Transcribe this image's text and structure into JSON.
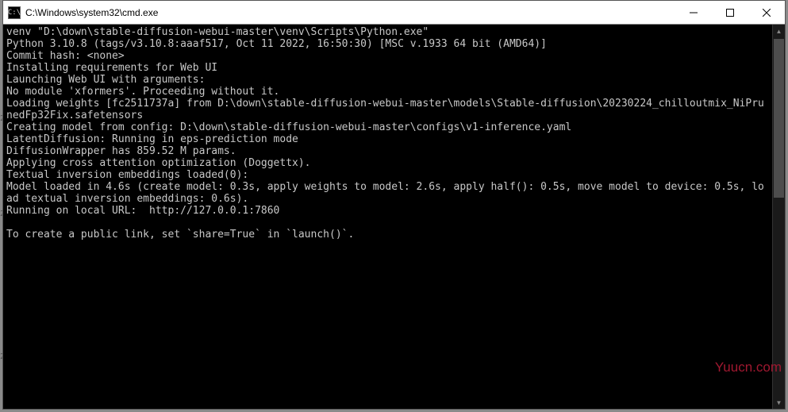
{
  "window": {
    "title": "C:\\Windows\\system32\\cmd.exe",
    "icon_label": "C:\\"
  },
  "terminal": {
    "lines": [
      "venv \"D:\\down\\stable-diffusion-webui-master\\venv\\Scripts\\Python.exe\"",
      "Python 3.10.8 (tags/v3.10.8:aaaf517, Oct 11 2022, 16:50:30) [MSC v.1933 64 bit (AMD64)]",
      "Commit hash: <none>",
      "Installing requirements for Web UI",
      "Launching Web UI with arguments:",
      "No module 'xformers'. Proceeding without it.",
      "Loading weights [fc2511737a] from D:\\down\\stable-diffusion-webui-master\\models\\Stable-diffusion\\20230224_chilloutmix_NiPrunedFp32Fix.safetensors",
      "Creating model from config: D:\\down\\stable-diffusion-webui-master\\configs\\v1-inference.yaml",
      "LatentDiffusion: Running in eps-prediction mode",
      "DiffusionWrapper has 859.52 M params.",
      "Applying cross attention optimization (Doggettx).",
      "Textual inversion embeddings loaded(0):",
      "Model loaded in 4.6s (create model: 0.3s, apply weights to model: 2.6s, apply half(): 0.5s, move model to device: 0.5s, load textual inversion embeddings: 0.6s).",
      "Running on local URL:  http://127.0.0.1:7860",
      "",
      "To create a public link, set `share=True` in `launch()`."
    ]
  },
  "watermark": "Yuucn.com"
}
